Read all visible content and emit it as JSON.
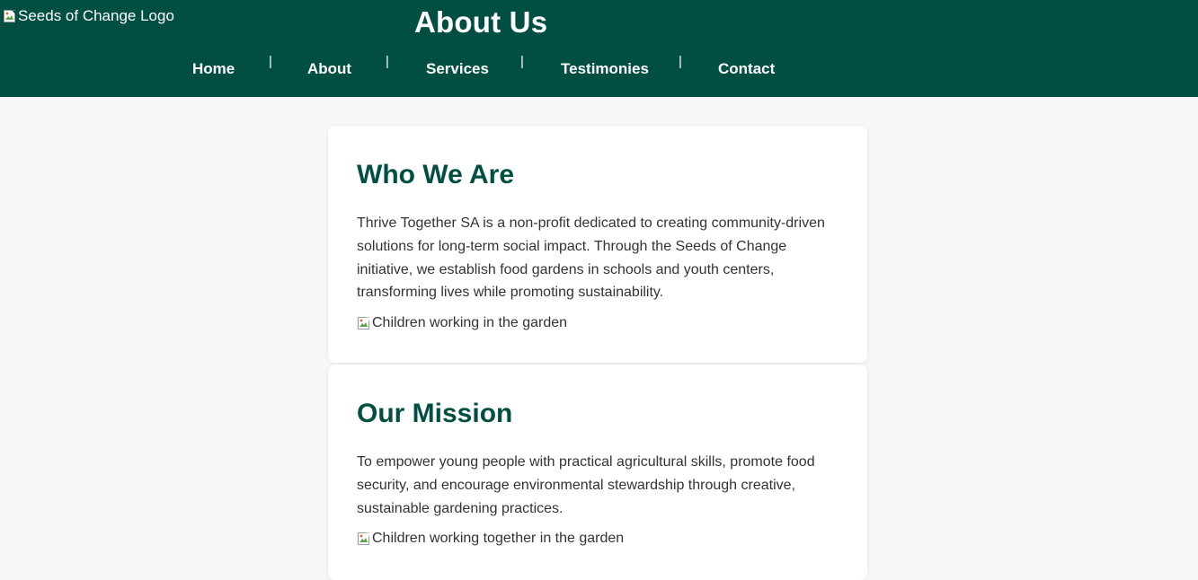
{
  "header": {
    "logo_alt": "Seeds of Change Logo",
    "title": "About Us",
    "nav": {
      "items": [
        "Home",
        "About",
        "Services",
        "Testimonies",
        "Contact"
      ],
      "separator": "|"
    },
    "background_color": "#004f42"
  },
  "sections": [
    {
      "heading": "Who We Are",
      "body": "Thrive Together SA is a non-profit dedicated to creating community-driven solutions for long-term social impact. Through the Seeds of Change initiative, we establish food gardens in schools and youth centers, transforming lives while promoting sustainability.",
      "image_alt": "Children working in the garden"
    },
    {
      "heading": "Our Mission",
      "body": "To empower young people with practical agricultural skills, promote food security, and encourage environmental stewardship through creative, sustainable gardening practices.",
      "image_alt": "Children working together in the garden"
    }
  ],
  "colors": {
    "accent": "#004f42",
    "page_background": "#f8f8f8",
    "card_background": "#ffffff",
    "text": "#333333"
  },
  "icons": {
    "broken_image": "broken-image-icon"
  }
}
